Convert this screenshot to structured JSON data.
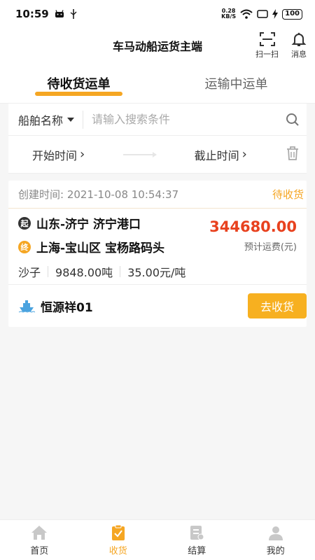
{
  "status_bar": {
    "time": "10:59",
    "speed_value": "0.28",
    "speed_unit": "KB/S",
    "battery": "100"
  },
  "header": {
    "title": "车马动船运货主端",
    "scan_label": "扫一扫",
    "message_label": "消息"
  },
  "tabs": [
    {
      "label": "待收货运单",
      "active": true
    },
    {
      "label": "运输中运单",
      "active": false
    }
  ],
  "search": {
    "select_label": "船舶名称",
    "placeholder": "请输入搜索条件"
  },
  "date_filter": {
    "start_label": "开始时间",
    "end_label": "截止时间"
  },
  "order": {
    "created": "创建时间: 2021-10-08 10:54:37",
    "status": "待收货",
    "start_badge": "起",
    "start": "山东-济宁 济宁港口",
    "end_badge": "终",
    "end": "上海-宝山区 宝杨路码头",
    "cargo": "沙子",
    "weight": "9848.00吨",
    "unit_price": "35.00元/吨",
    "price": "344680.00",
    "price_label": "预计运费(元)",
    "ship_name": "恒源祥01",
    "action_label": "去收货"
  },
  "bottom_nav": [
    {
      "label": "首页",
      "icon": "home-icon"
    },
    {
      "label": "收货",
      "icon": "receive-clipboard-icon",
      "active": true
    },
    {
      "label": "结算",
      "icon": "settlement-icon"
    },
    {
      "label": "我的",
      "icon": "profile-icon"
    }
  ],
  "colors": {
    "accent": "#f5a623",
    "price": "#e8411e"
  }
}
